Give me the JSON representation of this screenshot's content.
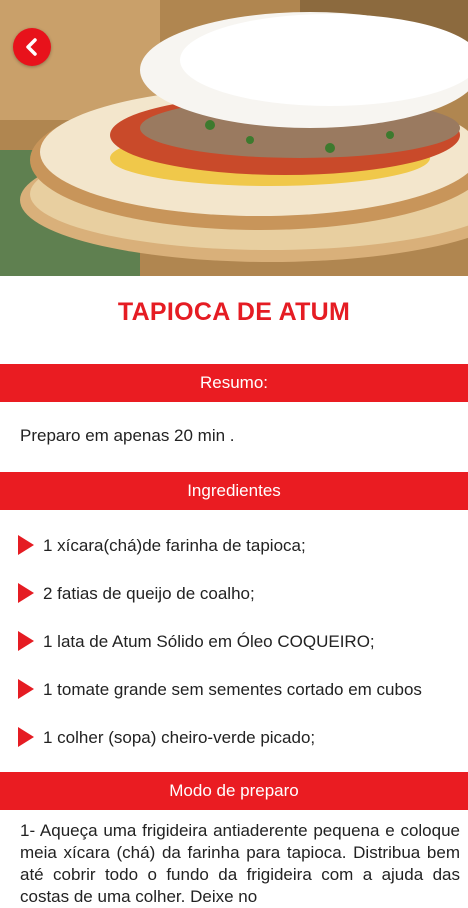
{
  "recipe": {
    "title": "TAPIOCA DE ATUM"
  },
  "sections": {
    "resumo_label": "Resumo:",
    "resumo_text": "Preparo em apenas 20 min .",
    "ingredients_label": "Ingredientes",
    "ingredients": [
      "1 xícara(chá)de farinha de tapioca;",
      "2 fatias de queijo de coalho;",
      "1 lata de Atum Sólido em Óleo COQUEIRO;",
      "1 tomate grande sem sementes cortado em cubos",
      "1 colher (sopa) cheiro-verde picado;"
    ],
    "modo_label": "Modo de preparo",
    "modo_text": "1- Aqueça uma frigideira antiaderente pequena e coloque meia xícara (chá) da farinha para tapioca. Distribua bem até cobrir todo o fundo da frigideira com a ajuda das costas de uma colher. Deixe no"
  },
  "icons": {
    "back": "chevron-left-icon",
    "bullet": "triangle-right-icon"
  },
  "colors": {
    "accent": "#e51c23",
    "bar": "#ea1c22"
  }
}
